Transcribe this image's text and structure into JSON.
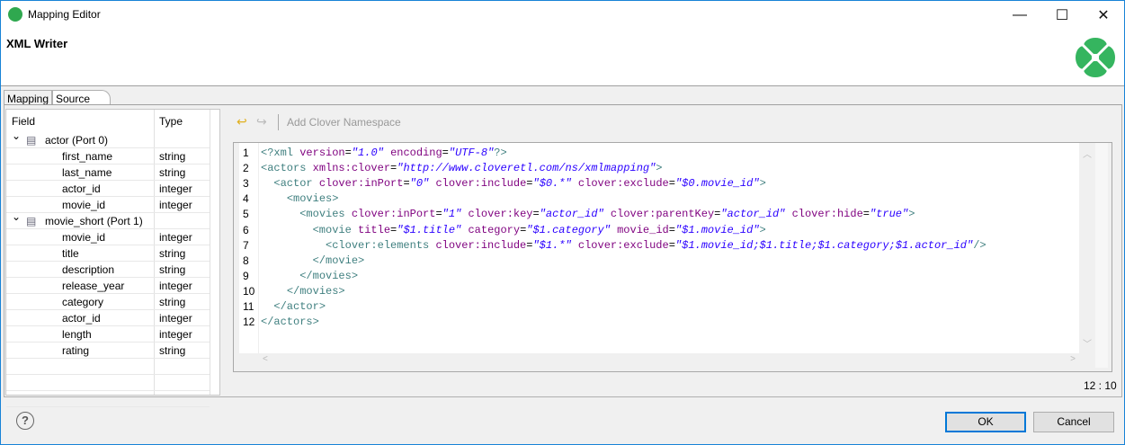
{
  "window": {
    "title": "Mapping Editor",
    "minimize": "—",
    "maximize": "☐",
    "close": "✕"
  },
  "header": {
    "title": "XML Writer"
  },
  "tabs": [
    {
      "label": "Mapping"
    },
    {
      "label": "Source"
    }
  ],
  "tree": {
    "columns": [
      "Field",
      "Type"
    ],
    "ports": [
      {
        "label": "actor (Port 0)",
        "fields": [
          [
            "first_name",
            "string"
          ],
          [
            "last_name",
            "string"
          ],
          [
            "actor_id",
            "integer"
          ],
          [
            "movie_id",
            "integer"
          ]
        ]
      },
      {
        "label": "movie_short (Port 1)",
        "fields": [
          [
            "movie_id",
            "integer"
          ],
          [
            "title",
            "string"
          ],
          [
            "description",
            "string"
          ],
          [
            "release_year",
            "integer"
          ],
          [
            "category",
            "string"
          ],
          [
            "actor_id",
            "integer"
          ],
          [
            "length",
            "integer"
          ],
          [
            "rating",
            "string"
          ]
        ]
      }
    ]
  },
  "toolbar": {
    "add_namespace": "Add Clover Namespace"
  },
  "editor": {
    "lines": [
      "<?xml version=\"1.0\" encoding=\"UTF-8\"?>",
      "<actors xmlns:clover=\"http://www.cloveretl.com/ns/xmlmapping\">",
      "  <actor clover:inPort=\"0\" clover:include=\"$0.*\" clover:exclude=\"$0.movie_id\">",
      "    <movies>",
      "      <movies clover:inPort=\"1\" clover:key=\"actor_id\" clover:parentKey=\"actor_id\" clover:hide=\"true\">",
      "        <movie title=\"$1.title\" category=\"$1.category\" movie_id=\"$1.movie_id\">",
      "          <clover:elements clover:include=\"$1.*\" clover:exclude=\"$1.movie_id;$1.title;$1.category;$1.actor_id\"/>",
      "        </movie>",
      "      </movies>",
      "    </movies>",
      "  </actor>",
      "</actors>"
    ],
    "cursor": "12 : 10"
  },
  "colors": {
    "tag": "#3f7f7f",
    "attribute": "#7f007f",
    "value": "#2a00ff",
    "brand": "#35b55f"
  },
  "buttons": {
    "ok": "OK",
    "cancel": "Cancel",
    "help": "?"
  }
}
